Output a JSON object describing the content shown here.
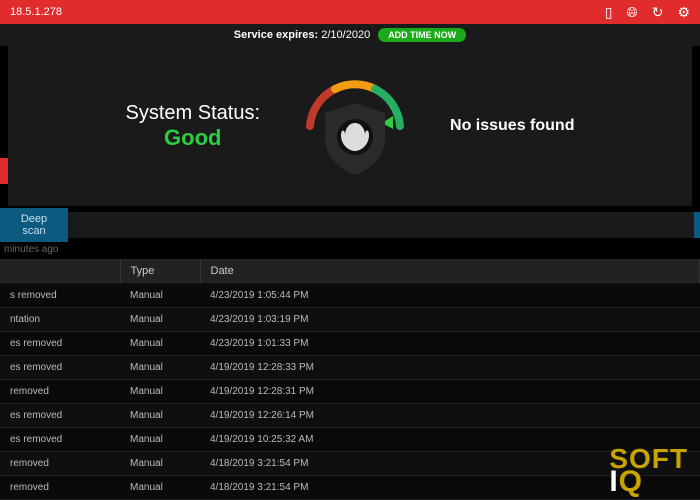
{
  "titlebar": {
    "version": "18.5.1.278"
  },
  "service": {
    "label": "Service expires:",
    "date": "2/10/2020",
    "add_time": "ADD TIME NOW"
  },
  "status": {
    "label": "System Status:",
    "value": "Good",
    "issues": "No issues found"
  },
  "scan": {
    "deep_scan": "Deep scan",
    "last": "minutes ago"
  },
  "columns": {
    "name": "",
    "type": "Type",
    "date": "Date"
  },
  "rows": [
    {
      "name": "s removed",
      "type": "Manual",
      "date": "4/23/2019 1:05:44 PM"
    },
    {
      "name": "ntation",
      "type": "Manual",
      "date": "4/23/2019 1:03:19 PM"
    },
    {
      "name": "es removed",
      "type": "Manual",
      "date": "4/23/2019 1:01:33 PM"
    },
    {
      "name": "es removed",
      "type": "Manual",
      "date": "4/19/2019 12:28:33 PM"
    },
    {
      "name": "removed",
      "type": "Manual",
      "date": "4/19/2019 12:28:31 PM"
    },
    {
      "name": "es removed",
      "type": "Manual",
      "date": "4/19/2019 12:26:14 PM"
    },
    {
      "name": "es removed",
      "type": "Manual",
      "date": "4/19/2019 10:25:32 AM"
    },
    {
      "name": "removed",
      "type": "Manual",
      "date": "4/18/2019 3:21:54 PM"
    },
    {
      "name": "removed",
      "type": "Manual",
      "date": "4/18/2019 3:21:54 PM"
    }
  ],
  "watermark": {
    "line1": "SOFT",
    "line2_i": "I",
    "line2_q": "Q"
  }
}
